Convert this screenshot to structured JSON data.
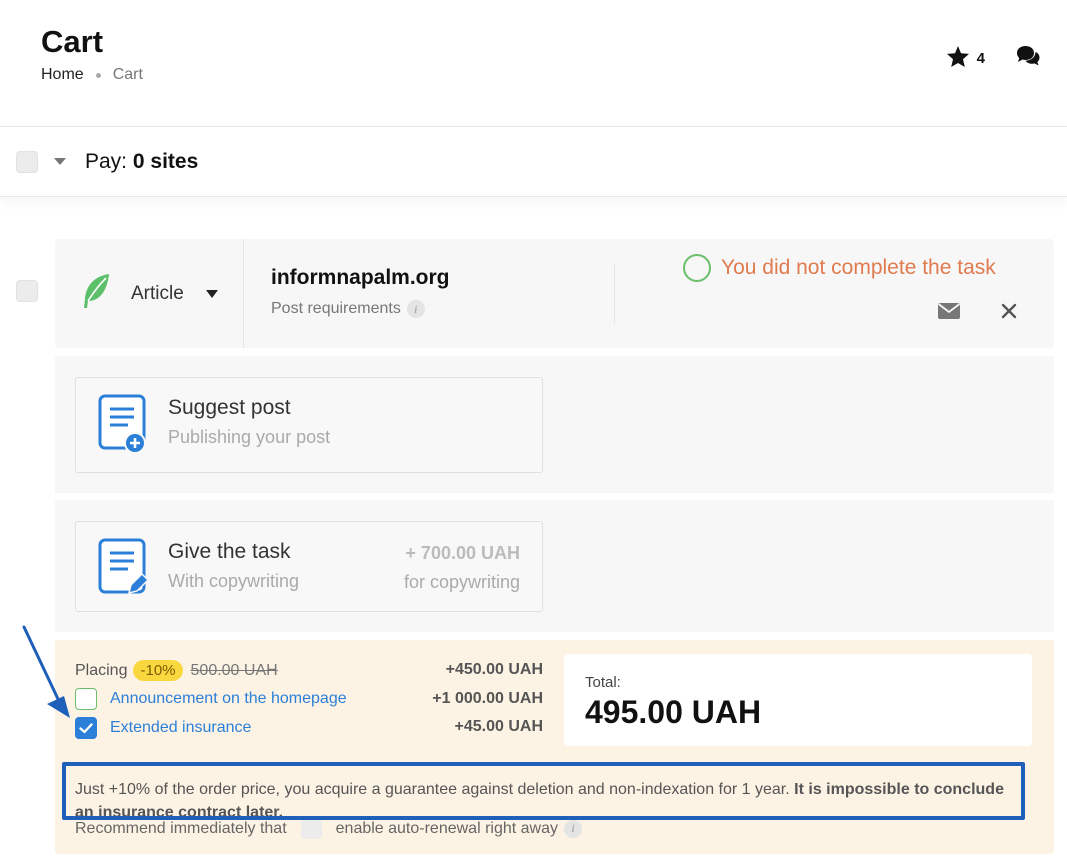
{
  "header": {
    "title": "Cart",
    "breadcrumb": {
      "home": "Home",
      "current": "Cart"
    },
    "favorites_count": "4"
  },
  "pay_bar": {
    "label": "Pay:",
    "value": "0 sites"
  },
  "site": {
    "type_label": "Article",
    "domain": "informnapalm.org",
    "post_requirements": "Post requirements",
    "task_status": "You did not complete the task"
  },
  "options": [
    {
      "title": "Suggest post",
      "subtitle": "Publishing your post",
      "price": "",
      "price_note": ""
    },
    {
      "title": "Give the task",
      "subtitle": "With copywriting",
      "price": "+ 700.00 UAH",
      "price_note": "for copywriting"
    }
  ],
  "placing": {
    "label": "Placing",
    "discount": "-10%",
    "old_price": "500.00 UAH",
    "amount": "+450.00 UAH",
    "announcement_label": "Announcement on the homepage",
    "announcement_amount": "+1 000.00 UAH",
    "announcement_checked": false,
    "insurance_label": "Extended insurance",
    "insurance_amount": "+45.00 UAH",
    "insurance_checked": true,
    "note_text": "Just +10% of the order price, you acquire a guarantee against deletion and non-indexation for 1 year.",
    "note_bold": "It is impossible to conclude an insurance contract later.",
    "renew_prefix": "Recommend immediately that",
    "renew_suffix": "enable auto-renewal right away"
  },
  "total": {
    "label": "Total:",
    "value": "495.00 UAH"
  },
  "colors": {
    "accent_blue": "#2b7fd8",
    "status_orange": "#e07b4f",
    "status_green": "#6cbf6a",
    "discount_yellow": "#f9d83f",
    "placing_bg": "#fdf3e5",
    "highlight_frame": "#1d5fb9"
  },
  "icons": {
    "star": "star-icon",
    "chat": "chat-icon",
    "feather": "feather-icon",
    "mail": "mail-icon",
    "close": "close-icon",
    "suggest": "document-plus-icon",
    "task": "document-pen-icon",
    "check": "check-icon",
    "info": "info-icon"
  }
}
